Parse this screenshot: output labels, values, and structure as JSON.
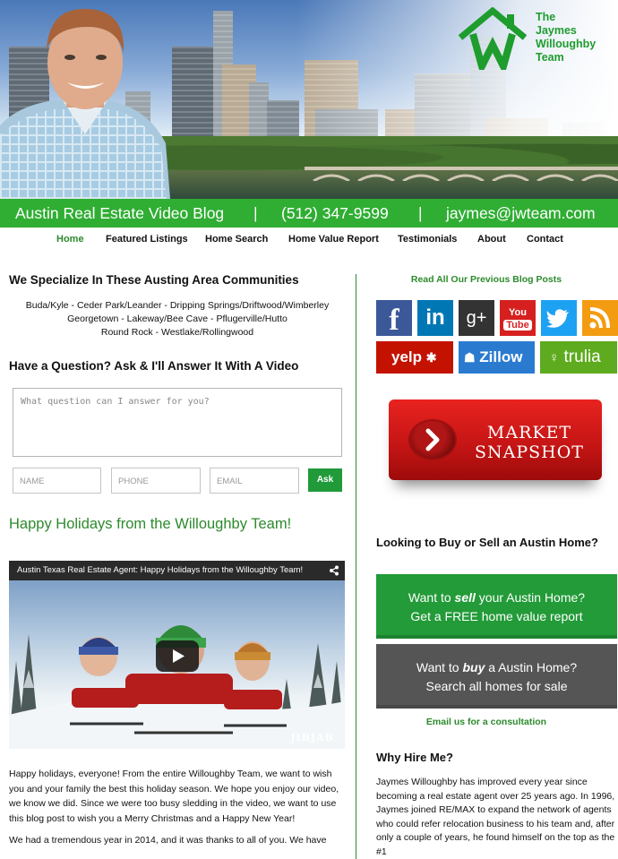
{
  "header": {
    "logo_line1": "The",
    "logo_line2": "Jaymes",
    "logo_line3": "Willoughby",
    "logo_line4": "Team",
    "blog_title": "Austin Real Estate Video Blog",
    "separator": "|",
    "phone": "(512) 347-9599",
    "email": "jaymes@jwteam.com",
    "accent_green": "#2fae33"
  },
  "nav": {
    "items": [
      "Home",
      "Featured Listings",
      "Home Search",
      "Home Value Report",
      "Testimonials",
      "About",
      "Contact"
    ],
    "active": "Home"
  },
  "left": {
    "specialize_heading": "We Specialize In These Austing Area Communities",
    "communities_line1": "Buda/Kyle - Ceder Park/Leander - Dripping Springs/Driftwood/Wimberley",
    "communities_line2": "Georgetown - Lakeway/Bee Cave - Pflugerville/Hutto",
    "communities_line3": "Round Rock - Westlake/Rollingwood",
    "ask_heading": "Have a Question? Ask & I'll Answer It With A Video",
    "question_placeholder": "What question can I answer for you?",
    "name_placeholder": "NAME",
    "phone_placeholder": "PHONE",
    "email_placeholder": "EMAIL",
    "ask_button": "Ask",
    "post_title": "Happy Holidays from the Willoughby Team!",
    "video_title": "Austin Texas Real Estate Agent: Happy Holidays from the Willoughby Team!",
    "video_watermark": "JIBJAB",
    "post_paragraph1": "Happy holidays, everyone! From the entire Willoughby Team, we want to wish you and your family the best this holiday season. We hope you enjoy our video, we know we did. Since we were too busy sledding in the video, we want to use this blog post to wish you a Merry Christmas and a Happy New Year!",
    "post_paragraph2": "We had a tremendous year in 2014, and it was thanks to all of you. We have"
  },
  "right": {
    "read_all": "Read All Our Previous Blog Posts",
    "social": {
      "facebook": "f",
      "linkedin": "in",
      "googleplus": "g+",
      "youtube_top": "You",
      "youtube_bottom": "Tube",
      "yelp": "yelp",
      "zillow": "Zillow",
      "trulia": "trulia"
    },
    "market_line1": "MARKET",
    "market_line2": "SNAPSHOT",
    "looking_heading": "Looking to Buy or Sell an Austin Home?",
    "sell_pre": "Want to ",
    "sell_em": "sell",
    "sell_post": " your Austin Home?",
    "sell_line2": "Get a FREE home value report",
    "buy_pre": "Want to ",
    "buy_em": "buy",
    "buy_post": " a Austin Home?",
    "buy_line2": "Search all homes for sale",
    "email_consult": "Email us for a consultation",
    "why_heading": "Why Hire Me?",
    "why_body": "Jaymes Willoughby has improved every year since becoming a real estate agent over 25 years ago. In 1996, Jaymes joined RE/MAX to expand the network of agents who could refer relocation business to his team and, after only a couple of years, he found himself on the top as the #1"
  }
}
